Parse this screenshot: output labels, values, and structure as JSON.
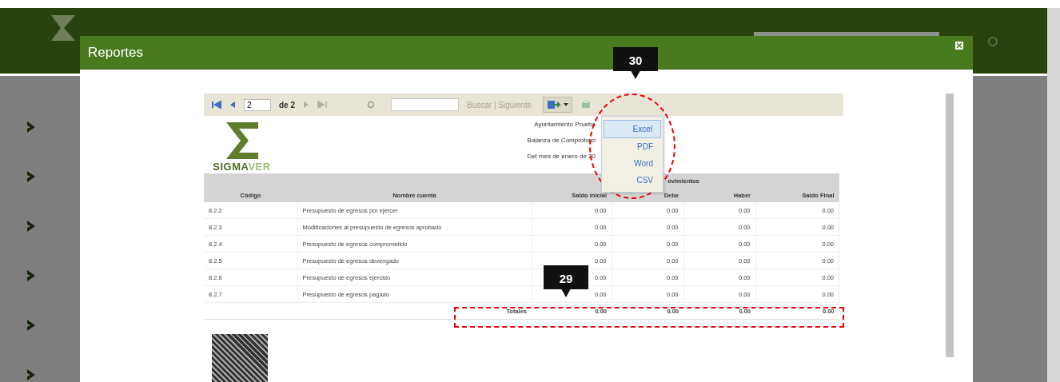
{
  "sidebar": {
    "items": [
      {
        "kind": "chevron"
      },
      {
        "kind": "chevron"
      },
      {
        "kind": "chevron"
      },
      {
        "kind": "chevron"
      },
      {
        "kind": "chevron"
      },
      {
        "kind": "chevron"
      }
    ]
  },
  "dialog": {
    "title": "Reportes",
    "toolbar": {
      "page": "2",
      "page_count": "de 2",
      "search_links": "Buscar | Siguiente",
      "last_disabled": true
    },
    "export_menu": [
      {
        "label": "Excel",
        "selected": true
      },
      {
        "label": "PDF",
        "selected": false
      },
      {
        "label": "Word",
        "selected": false
      },
      {
        "label": "CSV",
        "selected": false
      }
    ],
    "report": {
      "logo": {
        "strong": "SIGMA",
        "light": "VER"
      },
      "heading": [
        "Ayuntamiento Prueba",
        "Balanza de Comprobaci",
        "Del mes de enero de 20"
      ],
      "group_header": "ovimientos",
      "columns": [
        "Código",
        "Nombre cuenta",
        "Saldo inicial",
        "Debe",
        "Haber",
        "Saldo Final"
      ],
      "rows": [
        [
          "8.2.2",
          "Presupuesto de egresos por ejercer",
          "0.00",
          "0.00",
          "0.00",
          "0.00"
        ],
        [
          "8.2.3",
          "Modificaciones al presupuesto de egresos aprobado",
          "0.00",
          "0.00",
          "0.00",
          "0.00"
        ],
        [
          "8.2.4",
          "Presupuesto de egresos comprometido",
          "0.00",
          "0.00",
          "0.00",
          "0.00"
        ],
        [
          "8.2.5",
          "Presupuesto de egresos devengado",
          "0.00",
          "0.00",
          "0.00",
          "0.00"
        ],
        [
          "8.2.6",
          "Presupuesto de egresos ejercido",
          "0.00",
          "0.00",
          "0.00",
          "0.00"
        ],
        [
          "8.2.7",
          "Presupuesto de egresos pagado",
          "0.00",
          "0.00",
          "0.00",
          "0.00"
        ]
      ],
      "totals": {
        "label": "Totales",
        "values": [
          "0.00",
          "0.00",
          "0.00",
          "0.00"
        ]
      }
    }
  },
  "callouts": [
    {
      "label": "30",
      "kind": "export"
    },
    {
      "label": "29",
      "kind": "totals"
    }
  ]
}
